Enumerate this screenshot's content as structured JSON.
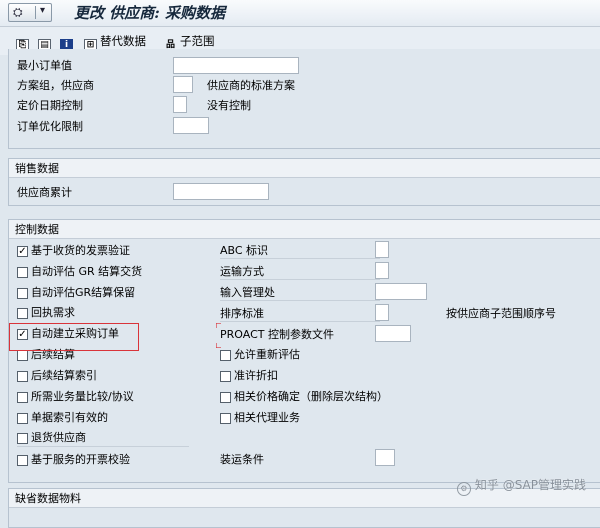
{
  "window": {
    "title": "更改 供应商: 采购数据",
    "menu_glyph": "⛭",
    "menu_arrow": "▾"
  },
  "toolbar": {
    "items": [
      {
        "icon": "copy-icon",
        "label": ""
      },
      {
        "icon": "document-icon",
        "label": ""
      },
      {
        "icon": "info-icon",
        "label": ""
      },
      {
        "icon": "alternate-data-icon",
        "label": "替代数据"
      },
      {
        "icon": "hierarchy-icon",
        "label": "子范围"
      }
    ]
  },
  "top_section": {
    "fields": [
      {
        "label": "最小订单值",
        "value": "",
        "note": ""
      },
      {
        "label": "方案组，供应商",
        "value": "",
        "note": "供应商的标准方案"
      },
      {
        "label": "定价日期控制",
        "value": "",
        "note": "没有控制"
      },
      {
        "label": "订单优化限制",
        "value": "",
        "note": ""
      }
    ]
  },
  "sales": {
    "title": "销售数据",
    "fields": [
      {
        "label": "供应商累计",
        "value": ""
      }
    ]
  },
  "control": {
    "title": "控制数据",
    "left": [
      {
        "label": "基于收货的发票验证",
        "checked": true
      },
      {
        "label": "自动评估 GR 结算交货",
        "checked": false
      },
      {
        "label": "自动评估GR结算保留",
        "checked": false
      },
      {
        "label": "回执需求",
        "checked": false
      },
      {
        "label": "自动建立采购订单",
        "checked": true
      },
      {
        "label": "后续结算",
        "checked": false
      },
      {
        "label": "后续结算索引",
        "checked": false
      },
      {
        "label": "所需业务量比较/协议",
        "checked": false
      },
      {
        "label": "单据索引有效的",
        "checked": false
      },
      {
        "label": "退货供应商",
        "checked": false
      },
      {
        "label": "基于服务的开票校验",
        "checked": false
      }
    ],
    "right_fields": [
      {
        "label": "ABC 标识",
        "value": ""
      },
      {
        "label": "运输方式",
        "value": ""
      },
      {
        "label": "输入管理处",
        "value": ""
      },
      {
        "label": "排序标准",
        "value": "",
        "note": "按供应商子范围顺序号"
      },
      {
        "label": "PROACT 控制参数文件",
        "value": ""
      }
    ],
    "right_checks": [
      {
        "label": "允许重新评估",
        "checked": false
      },
      {
        "label": "准许折扣",
        "checked": false
      },
      {
        "label": "相关价格确定（删除层次结构）",
        "checked": false
      },
      {
        "label": "相关代理业务",
        "checked": false
      }
    ],
    "shipping": {
      "label": "装运条件",
      "value": ""
    }
  },
  "default_material": {
    "title": "缺省数据物料"
  },
  "watermark": "知乎 @SAP管理实践"
}
